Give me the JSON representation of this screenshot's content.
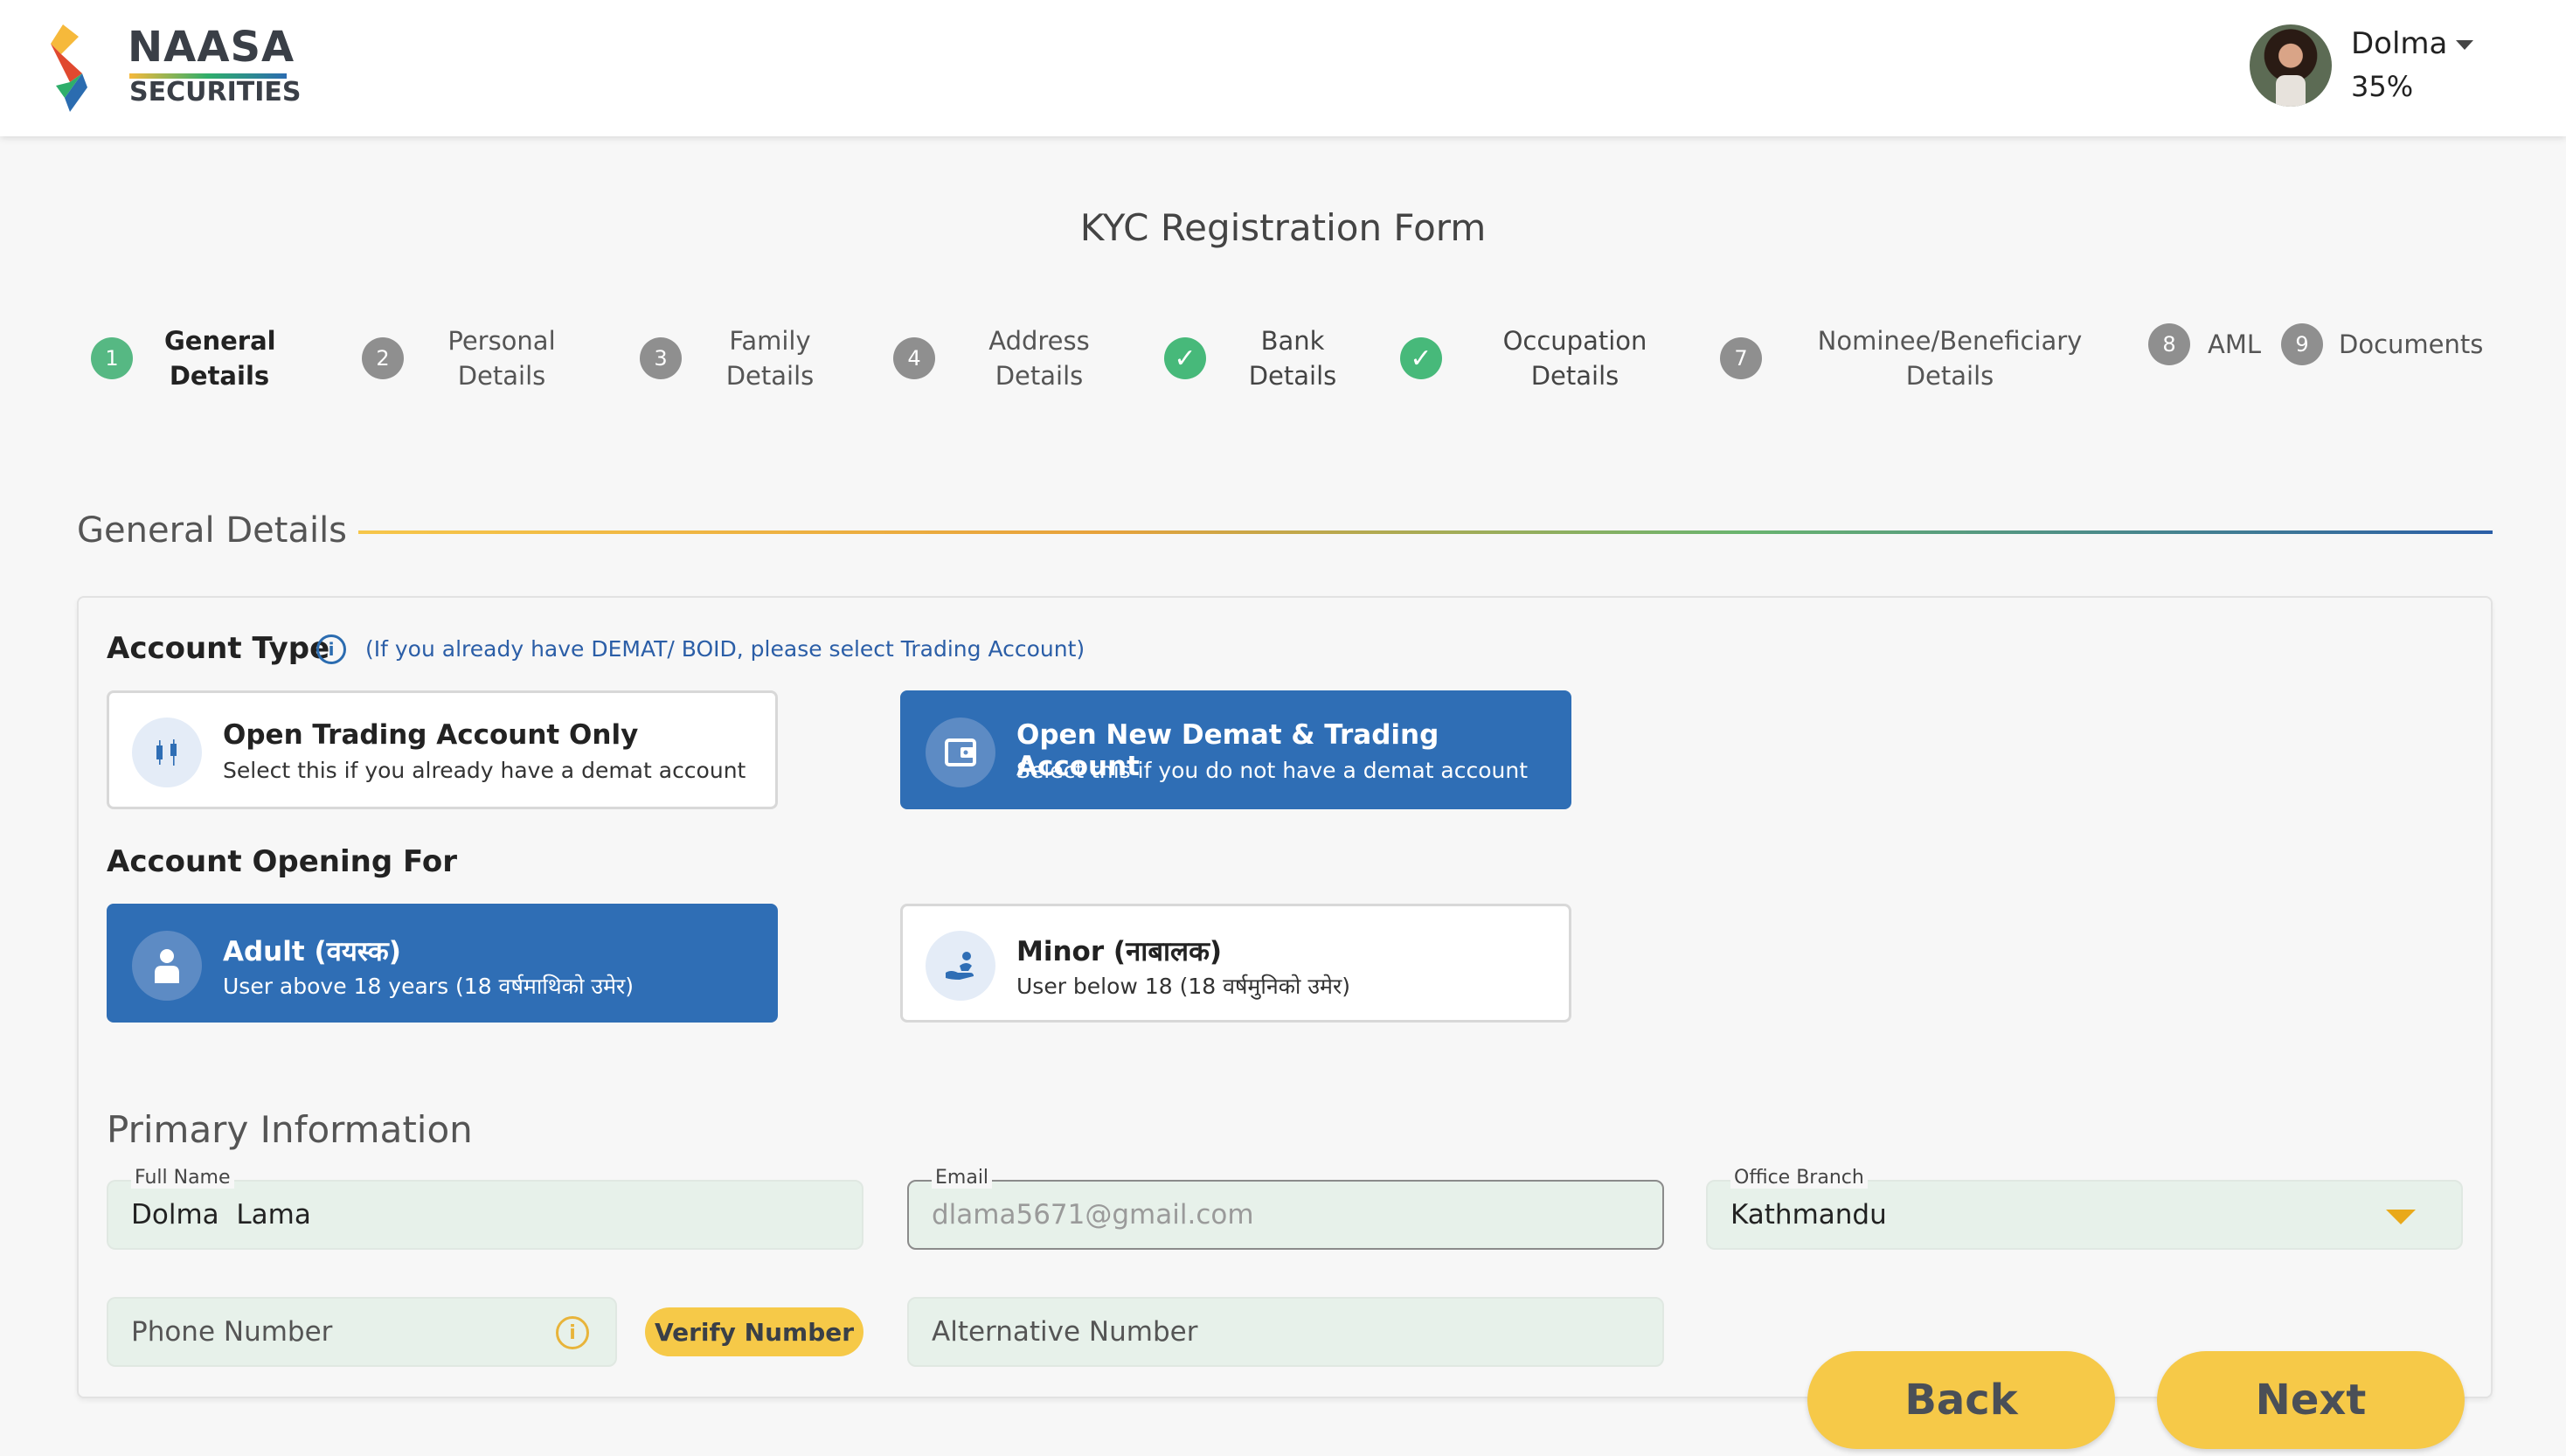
{
  "header": {
    "brand_name": "NAASA",
    "brand_sub": "SECURITIES",
    "user_name": "Dolma",
    "user_progress": "35%"
  },
  "form_title": "KYC Registration Form",
  "steps": [
    {
      "num": "1",
      "label": "General Details",
      "state": "active"
    },
    {
      "num": "2",
      "label": "Personal Details",
      "state": "pending"
    },
    {
      "num": "3",
      "label": "Family Details",
      "state": "pending"
    },
    {
      "num": "4",
      "label": "Address Details",
      "state": "pending"
    },
    {
      "num": "✓",
      "label": "Bank Details",
      "state": "done"
    },
    {
      "num": "✓",
      "label": "Occupation Details",
      "state": "done"
    },
    {
      "num": "7",
      "label": "Nominee/Beneficiary Details",
      "state": "pending"
    },
    {
      "num": "8",
      "label": "AML",
      "state": "pending"
    },
    {
      "num": "9",
      "label": "Documents",
      "state": "pending"
    }
  ],
  "section": {
    "title": "General Details"
  },
  "account_type": {
    "label": "Account Type",
    "hint": "(If you already have DEMAT/ BOID, please select Trading Account)",
    "options": [
      {
        "title": "Open Trading Account Only",
        "subtitle": "Select this if you already have a demat account",
        "selected": false
      },
      {
        "title": "Open New Demat & Trading Account",
        "subtitle": "Select this if you do not have a demat account",
        "selected": true
      }
    ]
  },
  "account_opening_for": {
    "label": "Account Opening For",
    "options": [
      {
        "title": "Adult (वयस्क)",
        "subtitle": "User above 18 years (18 वर्षमाथिको उमेर)",
        "selected": true
      },
      {
        "title": "Minor (नाबालक)",
        "subtitle": "User below 18 (18 वर्षमुनिको उमेर)",
        "selected": false
      }
    ]
  },
  "primary_info": {
    "title": "Primary Information",
    "full_name": {
      "label": "Full Name",
      "value": "Dolma  Lama"
    },
    "email": {
      "label": "Email",
      "value": "dlama5671@gmail.com"
    },
    "office_branch": {
      "label": "Office Branch",
      "value": "Kathmandu"
    },
    "phone": {
      "placeholder": "Phone Number"
    },
    "verify_label": "Verify Number",
    "alt_phone": {
      "placeholder": "Alternative Number"
    }
  },
  "nav": {
    "back_label": "Back",
    "next_label": "Next"
  },
  "colors": {
    "primary_blue": "#2f6eb5",
    "accent_yellow": "#f6c948",
    "step_done_green": "#47b97a",
    "field_bg": "#e7f1ea"
  }
}
